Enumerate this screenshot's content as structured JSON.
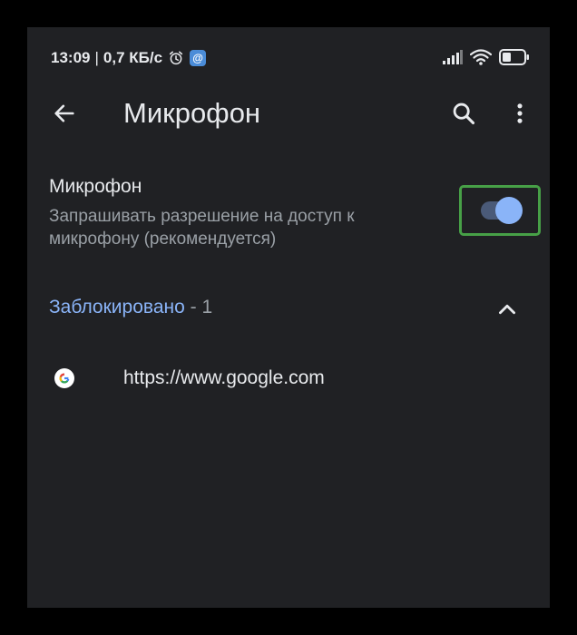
{
  "status_bar": {
    "time": "13:09",
    "separator": "|",
    "network_speed": "0,7 КБ/с",
    "notification_badge": "@",
    "icons": [
      "alarm-icon",
      "notification-icon",
      "signal-icon",
      "wifi-icon",
      "battery-icon"
    ]
  },
  "app_bar": {
    "title": "Микрофон",
    "icons": [
      "arrow-back-icon",
      "search-icon",
      "more-vert-icon"
    ]
  },
  "setting": {
    "title": "Микрофон",
    "description": "Запрашивать разрешение на доступ к микрофону (рекомендуется)",
    "enabled": true
  },
  "blocked_section": {
    "label": "Заблокировано",
    "count_text": " - 1",
    "expanded": true,
    "icon": "chevron-up-icon"
  },
  "blocked_sites": [
    {
      "url": "https://www.google.com",
      "icon": "google-icon"
    }
  ],
  "colors": {
    "background": "#202124",
    "accent": "#8ab4f8",
    "text_primary": "#e8eaed",
    "text_secondary": "#9aa0a6",
    "highlight_border": "#47a047"
  }
}
